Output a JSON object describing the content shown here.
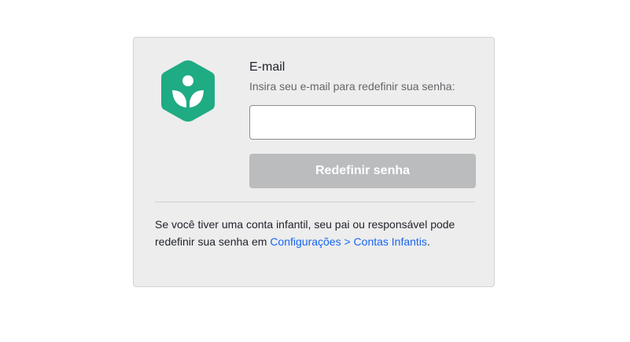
{
  "brand": {
    "logo_icon": "khan-academy-hexagon-logo",
    "logo_color": "#1fab83"
  },
  "form": {
    "title": "E-mail",
    "description": "Insira seu e-mail para redefinir sua senha:",
    "email_value": "",
    "reset_button_label": "Redefinir senha"
  },
  "note": {
    "text_before_link": "Se você tiver uma conta infantil, seu pai ou responsável pode redefinir sua senha em ",
    "link_text": "Configurações > Contas Infantis",
    "text_after_link": "."
  },
  "colors": {
    "card_background": "#ededed",
    "button_disabled": "#babcbd",
    "link": "#1865f2"
  }
}
